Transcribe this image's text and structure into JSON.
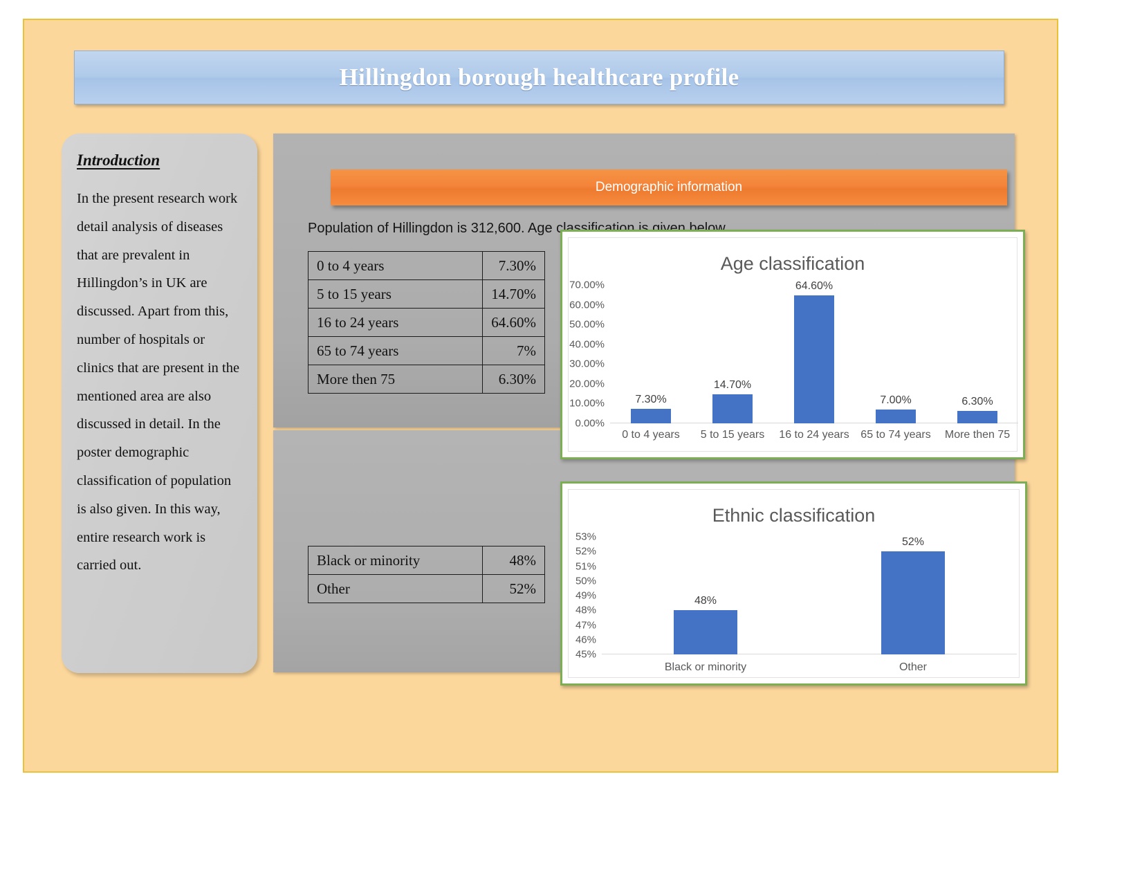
{
  "poster": {
    "title": "Hillingdon borough healthcare profile",
    "background_color": "#FCD79C",
    "border_color": "#E8C33A",
    "title_band_color": "#AFCAEA",
    "accent_color": "#F4843A",
    "panel_color": "#B2B2B2",
    "chart_border_color": "#7CAF54",
    "bar_color": "#4472C4"
  },
  "intro": {
    "heading": "Introduction",
    "body": "In the present research work detail analysis of diseases that are prevalent in Hillingdon’s in UK are discussed. Apart from this, number of hospitals or clinics that are present in the mentioned area are also discussed in detail. In the poster demographic classification of population is also given. In this way, entire research work is carried out."
  },
  "demographic": {
    "banner_label": "Demographic information",
    "caption": "Population of Hillingdon is 312,600. Age classification is given below."
  },
  "age_table": {
    "rows": [
      {
        "label": "0 to 4 years",
        "value": "7.30%"
      },
      {
        "label": "5 to 15 years",
        "value": "14.70%"
      },
      {
        "label": "16 to 24 years",
        "value": "64.60%"
      },
      {
        "label": "65 to 74 years",
        "value": "7%"
      },
      {
        "label": "More then 75",
        "value": "6.30%"
      }
    ]
  },
  "ethnic_table": {
    "rows": [
      {
        "label": "Black or minority",
        "value": "48%"
      },
      {
        "label": "Other",
        "value": "52%"
      }
    ]
  },
  "chart_data": [
    {
      "type": "bar",
      "id": "age-classification",
      "title": "Age classification",
      "xlabel": "",
      "ylabel": "",
      "categories": [
        "0 to 4 years",
        "5 to 15 years",
        "16 to 24 years",
        "65 to 74 years",
        "More then 75"
      ],
      "values": [
        7.3,
        14.7,
        64.6,
        7.0,
        6.3
      ],
      "data_labels": [
        "7.30%",
        "14.70%",
        "64.60%",
        "7.00%",
        "6.30%"
      ],
      "ytick_labels": [
        "70.00%",
        "60.00%",
        "50.00%",
        "40.00%",
        "30.00%",
        "20.00%",
        "10.00%",
        "0.00%"
      ],
      "ytick_values": [
        70,
        60,
        50,
        40,
        30,
        20,
        10,
        0
      ],
      "ylim": [
        0,
        70
      ],
      "grid": false,
      "legend": false,
      "series_color": "#4472C4"
    },
    {
      "type": "bar",
      "id": "ethnic-classification",
      "title": "Ethnic classification",
      "xlabel": "",
      "ylabel": "",
      "categories": [
        "Black or minority",
        "Other"
      ],
      "values": [
        48,
        52
      ],
      "data_labels": [
        "48%",
        "52%"
      ],
      "ytick_labels": [
        "53%",
        "52%",
        "51%",
        "50%",
        "49%",
        "48%",
        "47%",
        "46%",
        "45%"
      ],
      "ytick_values": [
        53,
        52,
        51,
        50,
        49,
        48,
        47,
        46,
        45
      ],
      "ylim": [
        45,
        53
      ],
      "grid": false,
      "legend": false,
      "series_color": "#4472C4"
    }
  ]
}
